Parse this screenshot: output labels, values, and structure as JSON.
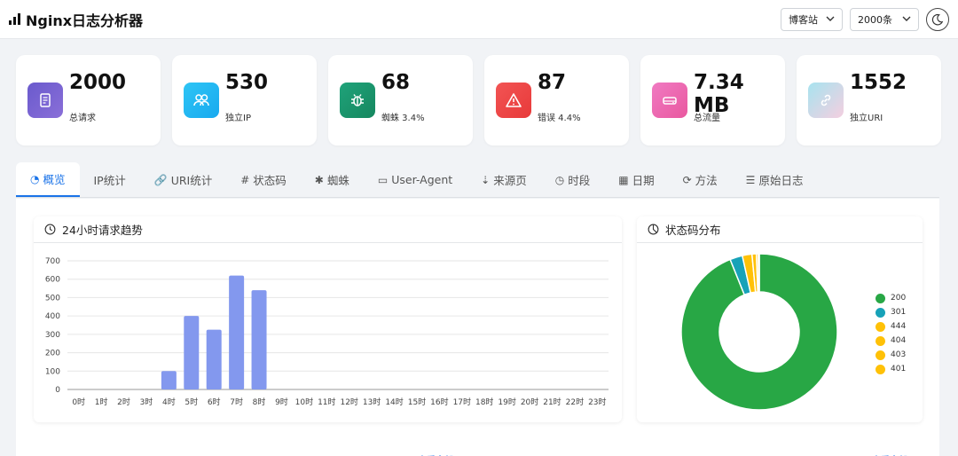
{
  "header": {
    "title": "Nginx日志分析器",
    "site_select": "博客站",
    "count_select": "2000条"
  },
  "stats": [
    {
      "value": "2000",
      "label": "总请求",
      "icon": "document-icon",
      "bg": "linear-gradient(135deg,#6a5acd,#8a6fd8)"
    },
    {
      "value": "530",
      "label": "独立IP",
      "icon": "users-icon",
      "bg": "linear-gradient(135deg,#2ec5f5,#18a9ef)"
    },
    {
      "value": "68",
      "label": "蜘蛛 3.4%",
      "icon": "bug-icon",
      "bg": "linear-gradient(135deg,#1fa37a,#16875f)"
    },
    {
      "value": "87",
      "label": "错误 4.4%",
      "icon": "warning-icon",
      "bg": "linear-gradient(135deg,#f25454,#e83a3a)"
    },
    {
      "value": "7.34 MB",
      "label": "总流量",
      "icon": "drive-icon",
      "bg": "linear-gradient(135deg,#f07ac2,#e9589f)"
    },
    {
      "value": "1552",
      "label": "独立URI",
      "icon": "link-icon",
      "bg": "linear-gradient(135deg,#a7e3ef,#f4cfe0)"
    }
  ],
  "tabs": [
    {
      "label": "概览",
      "icon": "◔",
      "name": "dashboard-icon",
      "active": true
    },
    {
      "label": "IP统计",
      "icon": "",
      "name": "",
      "active": false
    },
    {
      "label": "URI统计",
      "icon": "🔗",
      "name": "link-icon",
      "active": false
    },
    {
      "label": "状态码",
      "icon": "#",
      "name": "hash-icon",
      "active": false
    },
    {
      "label": "蜘蛛",
      "icon": "✱",
      "name": "bug-icon",
      "active": false
    },
    {
      "label": "User-Agent",
      "icon": "▭",
      "name": "laptop-icon",
      "active": false
    },
    {
      "label": "来源页",
      "icon": "⇣",
      "name": "signpost-icon",
      "active": false
    },
    {
      "label": "时段",
      "icon": "◷",
      "name": "clock-icon",
      "active": false
    },
    {
      "label": "日期",
      "icon": "▦",
      "name": "calendar-icon",
      "active": false
    },
    {
      "label": "方法",
      "icon": "⟳",
      "name": "refresh-icon",
      "active": false
    },
    {
      "label": "原始日志",
      "icon": "☰",
      "name": "list-icon",
      "active": false
    }
  ],
  "panels": {
    "trend_title": "24小时请求趋势",
    "status_title": "状态码分布"
  },
  "chart_data": [
    {
      "type": "bar",
      "title": "24小时请求趋势",
      "categories": [
        "0时",
        "1时",
        "2时",
        "3时",
        "4时",
        "5时",
        "6时",
        "7时",
        "8时",
        "9时",
        "10时",
        "11时",
        "12时",
        "13时",
        "14时",
        "15时",
        "16时",
        "17时",
        "18时",
        "19时",
        "20时",
        "21时",
        "22时",
        "23时"
      ],
      "values": [
        0,
        0,
        0,
        0,
        100,
        400,
        325,
        620,
        540,
        0,
        0,
        0,
        0,
        0,
        0,
        0,
        0,
        0,
        0,
        0,
        0,
        0,
        0,
        0
      ],
      "ylim": [
        0,
        700
      ],
      "yticks": [
        0,
        100,
        200,
        300,
        400,
        500,
        600,
        700
      ],
      "grid": true,
      "color": "#8398ee"
    },
    {
      "type": "pie",
      "title": "状态码分布",
      "labels": [
        "200",
        "301",
        "444",
        "404",
        "403",
        "401"
      ],
      "values": [
        1878,
        52,
        40,
        18,
        8,
        4
      ],
      "colors": [
        "#28a745",
        "#17a2b8",
        "#ffc107",
        "#ffc107",
        "#ffc107",
        "#ffc107"
      ],
      "legend": "right"
    }
  ]
}
